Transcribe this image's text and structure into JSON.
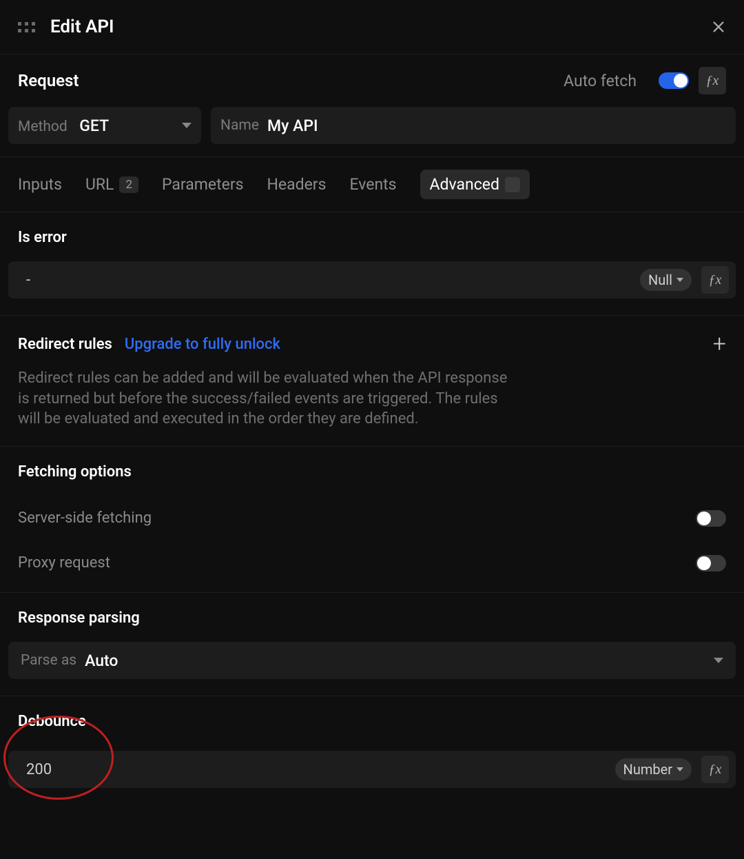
{
  "header": {
    "title": "Edit API"
  },
  "request": {
    "title": "Request",
    "auto_fetch_label": "Auto fetch",
    "method_label": "Method",
    "method_value": "GET",
    "name_label": "Name",
    "name_value": "My API"
  },
  "tabs": {
    "inputs": "Inputs",
    "url": "URL",
    "url_badge": "2",
    "parameters": "Parameters",
    "headers": "Headers",
    "events": "Events",
    "advanced": "Advanced"
  },
  "is_error": {
    "title": "Is error",
    "value": "-",
    "type": "Null"
  },
  "redirect": {
    "title": "Redirect rules",
    "upgrade": "Upgrade to fully unlock",
    "description": "Redirect rules can be added and will be evaluated when the API response is returned but before the success/failed events are triggered. The rules will be evaluated and executed in the order they are defined."
  },
  "fetching": {
    "title": "Fetching options",
    "server_side": "Server-side fetching",
    "proxy": "Proxy request"
  },
  "response_parsing": {
    "title": "Response parsing",
    "parse_as_label": "Parse as",
    "parse_as_value": "Auto"
  },
  "debounce": {
    "title": "Debounce",
    "value": "200",
    "type": "Number"
  }
}
